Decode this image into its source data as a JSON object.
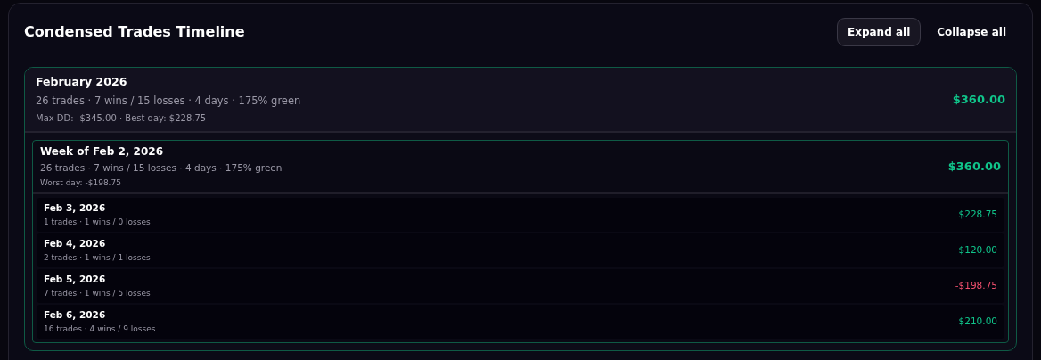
{
  "title": "Condensed Trades Timeline",
  "buttons": [
    {
      "label": "Expand all",
      "selected": true
    },
    {
      "label": "Collapse all",
      "selected": false
    }
  ],
  "month": {
    "title": "February 2026",
    "stats": "26 trades · 7 wins / 15 losses · 4 days · 175% green",
    "extra": "Max DD: -$345.00 · Best day: $228.75",
    "amount": "$360.00",
    "positive": true,
    "expanded": true,
    "weeks": [
      {
        "title": "Week of Feb 2, 2026",
        "stats": "26 trades · 7 wins / 15 losses · 4 days · 175% green",
        "extra": "Worst day: -$198.75",
        "amount": "$360.00",
        "positive": true,
        "expanded": true,
        "days": [
          {
            "title": "Feb 3, 2026",
            "stats": "1 trades · 1 wins / 0 losses",
            "amount": "$228.75",
            "positive": true
          },
          {
            "title": "Feb 4, 2026",
            "stats": "2 trades · 1 wins / 1 losses",
            "amount": "$120.00",
            "positive": true
          },
          {
            "title": "Feb 5, 2026",
            "stats": "7 trades · 1 wins / 5 losses",
            "amount": "-$198.75",
            "positive": false
          },
          {
            "title": "Feb 6, 2026",
            "stats": "16 trades · 4 wins / 9 losses",
            "amount": "$210.00",
            "positive": true
          }
        ]
      }
    ]
  }
}
